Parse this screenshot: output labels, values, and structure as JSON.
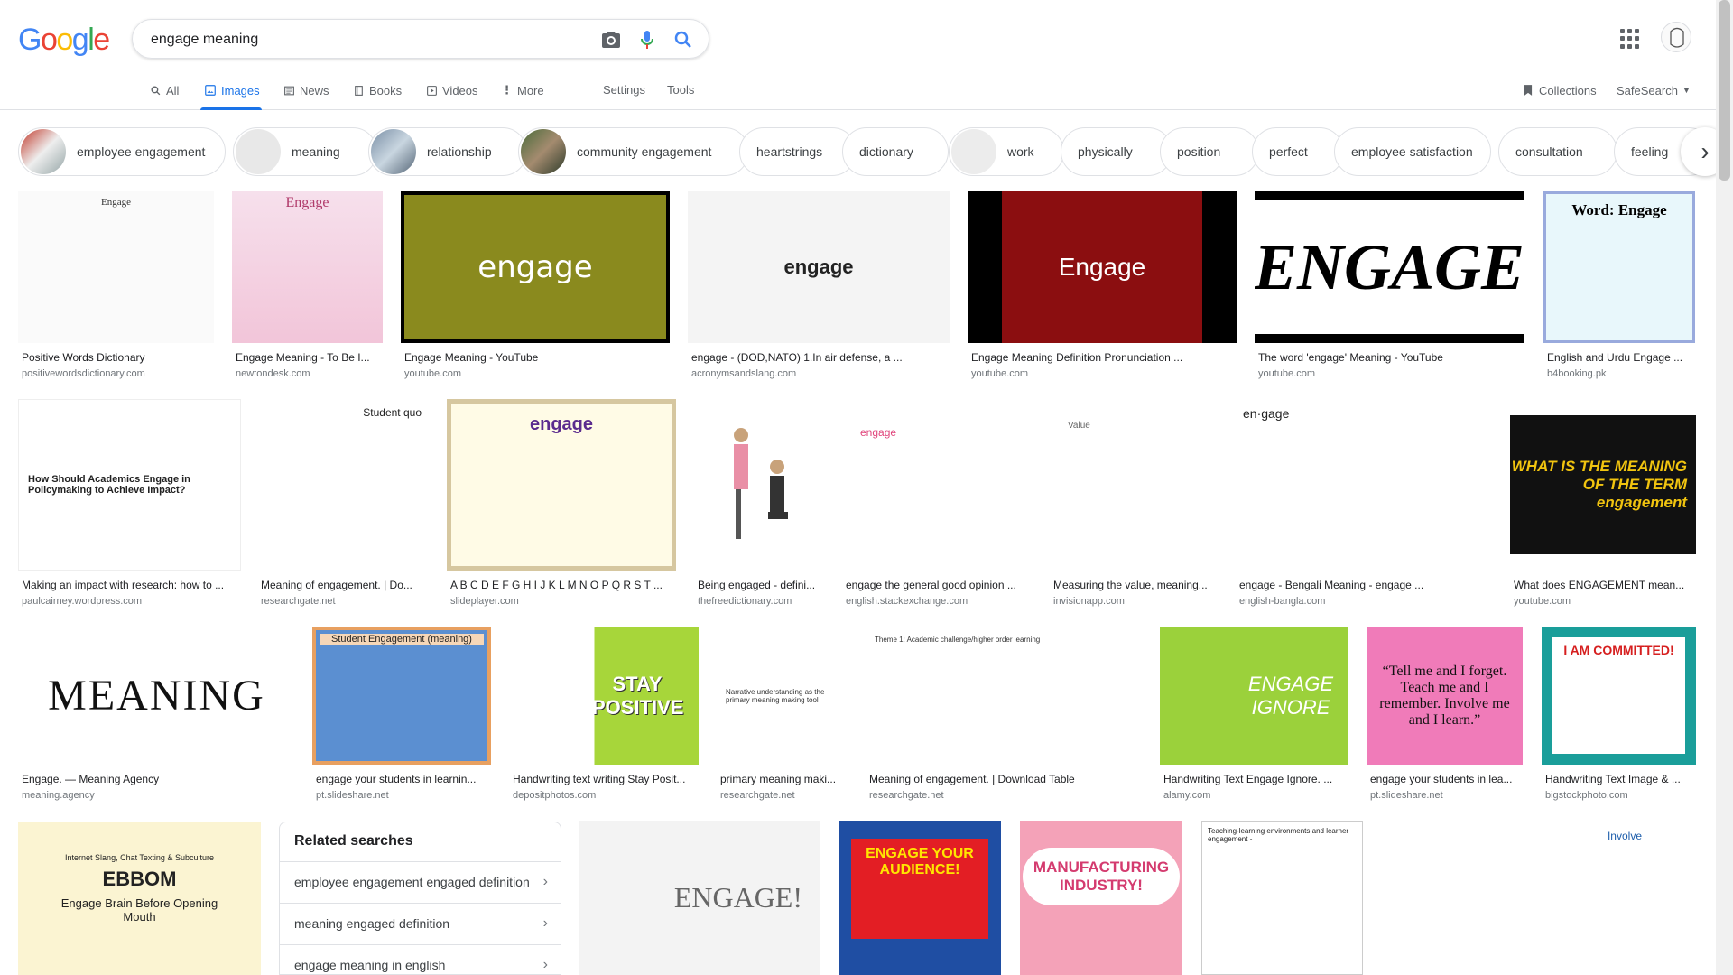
{
  "logo_text": [
    "G",
    "o",
    "o",
    "g",
    "l",
    "e"
  ],
  "search": {
    "query": "engage meaning"
  },
  "tabs": [
    {
      "label": "All",
      "icon": "search-icon"
    },
    {
      "label": "Images",
      "icon": "image-icon"
    },
    {
      "label": "News",
      "icon": "news-icon"
    },
    {
      "label": "Books",
      "icon": "book-icon"
    },
    {
      "label": "Videos",
      "icon": "video-icon"
    },
    {
      "label": "More",
      "icon": "more-vert-icon"
    }
  ],
  "settings_label": "Settings",
  "tools_label": "Tools",
  "collections_label": "Collections",
  "safesearch_label": "SafeSearch",
  "chips": [
    "employee engagement",
    "meaning",
    "relationship",
    "community engagement",
    "heartstrings",
    "dictionary",
    "work",
    "physically",
    "position",
    "perfect",
    "employee satisfaction",
    "consultation",
    "feeling"
  ],
  "results": {
    "r1": [
      {
        "title": "Positive Words Dictionary",
        "source": "positivewordsdictionary.com",
        "img_text": "Engage"
      },
      {
        "title": "Engage Meaning - To Be I...",
        "source": "newtondesk.com",
        "img_text": "Engage"
      },
      {
        "title": "Engage Meaning - YouTube",
        "source": "youtube.com",
        "img_text": "engage"
      },
      {
        "title": "engage - (DOD,NATO) 1.In air defense, a ...",
        "source": "acronymsandslang.com",
        "img_text": "engage"
      },
      {
        "title": "Engage Meaning Definition Pronunciation ...",
        "source": "youtube.com",
        "img_text": "Engage"
      },
      {
        "title": "The word 'engage' Meaning - YouTube",
        "source": "youtube.com",
        "img_text": "ENGAGE"
      },
      {
        "title": "English and Urdu Engage ...",
        "source": "b4booking.pk",
        "img_text": "Word: Engage"
      }
    ],
    "r2": [
      {
        "title": "Making an impact with research: how to ...",
        "source": "paulcairney.wordpress.com",
        "img_text": "How Should Academics Engage in Policymaking to Achieve Impact?"
      },
      {
        "title": "Meaning of engagement. | Do...",
        "source": "researchgate.net",
        "img_text": "Student quo"
      },
      {
        "title": "A B C D E F G H I J K L M N O P Q R S T ...",
        "source": "slideplayer.com",
        "img_text": "engage"
      },
      {
        "title": "Being engaged - defini...",
        "source": "thefreedictionary.com",
        "img_text": ""
      },
      {
        "title": "engage the general good opinion ...",
        "source": "english.stackexchange.com",
        "img_text": "engage"
      },
      {
        "title": "Measuring the value, meaning...",
        "source": "invisionapp.com",
        "img_text": "Value"
      },
      {
        "title": "engage - Bengali Meaning - engage ...",
        "source": "english-bangla.com",
        "img_text": "en·gage"
      },
      {
        "title": "What does ENGAGEMENT mean...",
        "source": "youtube.com",
        "img_text": "WHAT IS THE MEANING OF THE TERM engagement"
      }
    ],
    "r3": [
      {
        "title": "Engage. — Meaning Agency",
        "source": "meaning.agency",
        "img_text": "MEANING"
      },
      {
        "title": "engage your students in learnin...",
        "source": "pt.slideshare.net",
        "img_text": "Student Engagement (meaning)"
      },
      {
        "title": "Handwriting text writing Stay Posit...",
        "source": "depositphotos.com",
        "img_text": "STAY POSITIVE"
      },
      {
        "title": "primary meaning maki...",
        "source": "researchgate.net",
        "img_text": "Narrative understanding as the primary meaning making tool"
      },
      {
        "title": "Meaning of engagement. | Download Table",
        "source": "researchgate.net",
        "img_text": "Theme 1: Academic challenge/higher order learning"
      },
      {
        "title": "Handwriting Text Engage Ignore. ...",
        "source": "alamy.com",
        "img_text": "ENGAGE IGNORE"
      },
      {
        "title": "engage your students in lea...",
        "source": "pt.slideshare.net",
        "img_text": "“Tell me and I forget. Teach me and I remember. Involve me and I learn.”"
      },
      {
        "title": "Handwriting Text Image & ...",
        "source": "bigstockphoto.com",
        "img_text": "I AM COMMITTED!"
      }
    ],
    "r4": [
      {
        "img_text": "EBBOM"
      },
      {
        "img_text": "ENGAGE!"
      },
      {
        "img_text": "ENGAGE YOUR AUDIENCE!"
      },
      {
        "img_text": "MANUFACTURING INDUSTRY!"
      },
      {
        "img_text": "Teaching-learning environments and learner engagement -"
      },
      {
        "img_text": "Involve"
      }
    ]
  },
  "ebbom": {
    "top": "Internet Slang, Chat Texting & Subculture",
    "sub": "Engage Brain Before Opening Mouth"
  },
  "related": {
    "heading": "Related searches",
    "items": [
      "employee engagement engaged definition",
      "meaning engaged definition",
      "engage meaning in english"
    ]
  }
}
